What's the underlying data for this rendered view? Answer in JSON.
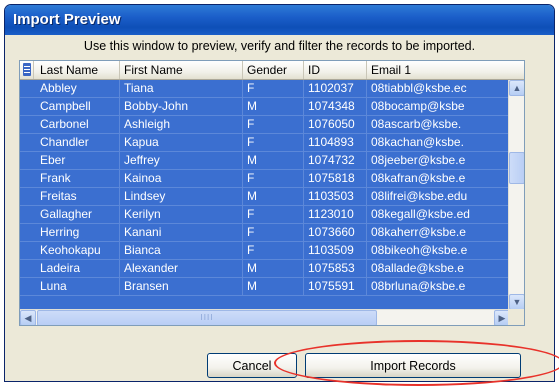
{
  "window": {
    "title": "Import Preview"
  },
  "instructions": "Use this window to preview, verify and filter the records to be imported.",
  "table": {
    "columns": [
      "Last Name",
      "First Name",
      "Gender",
      "ID",
      "Email 1"
    ],
    "rows": [
      [
        "Abbley",
        "Tiana",
        "F",
        "1102037",
        "08tiabbl@ksbe.ec"
      ],
      [
        "Campbell",
        "Bobby-John",
        "M",
        "1074348",
        "08bocamp@ksbe"
      ],
      [
        "Carbonel",
        "Ashleigh",
        "F",
        "1076050",
        "08ascarb@ksbe."
      ],
      [
        "Chandler",
        "Kapua",
        "F",
        "1104893",
        "08kachan@ksbe."
      ],
      [
        "Eber",
        "Jeffrey",
        "M",
        "1074732",
        "08jeeber@ksbe.e"
      ],
      [
        "Frank",
        "Kainoa",
        "F",
        "1075818",
        "08kafran@ksbe.e"
      ],
      [
        "Freitas",
        "Lindsey",
        "M",
        "1103503",
        "08lifrei@ksbe.edu"
      ],
      [
        "Gallagher",
        "Kerilyn",
        "F",
        "1123010",
        "08kegall@ksbe.ed"
      ],
      [
        "Herring",
        "Kanani",
        "F",
        "1073660",
        "08kaherr@ksbe.e"
      ],
      [
        "Keohokapu",
        "Bianca",
        "F",
        "1103509",
        "08bikeoh@ksbe.e"
      ],
      [
        "Ladeira",
        "Alexander",
        "M",
        "1075853",
        "08allade@ksbe.e"
      ],
      [
        "Luna",
        "Bransen",
        "M",
        "1075591",
        "08brluna@ksbe.e"
      ]
    ]
  },
  "scrollbar": {
    "grip": "IIII"
  },
  "buttons": {
    "cancel": "Cancel",
    "import": "Import Records"
  },
  "colors": {
    "selection": "#3b6fd0",
    "title_bar": "#0e4fb7",
    "annotation": "#e8322a"
  }
}
